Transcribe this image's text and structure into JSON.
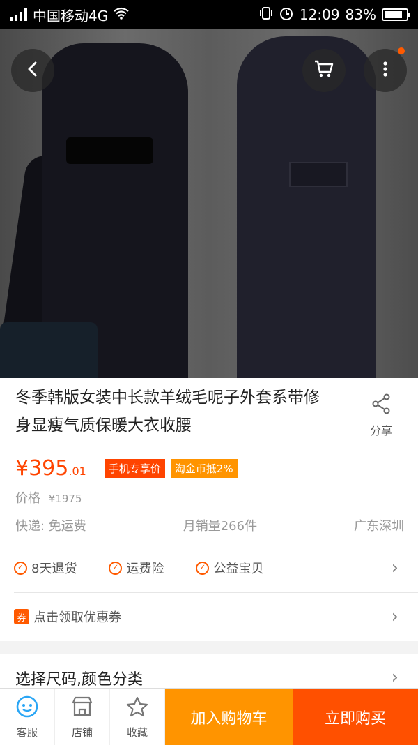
{
  "status_bar": {
    "carrier": "中国移动4G",
    "time": "12:09",
    "battery": "83%",
    "battery_level": 0.83
  },
  "hero": {
    "carousel_count": 4,
    "carousel_active": 0,
    "icons": [
      "back-icon",
      "cart-icon",
      "more-icon"
    ]
  },
  "product": {
    "title": "冬季韩版女装中长款羊绒毛呢子外套系带修身显瘦气质保暖大衣收腰",
    "share_label": "分享",
    "price_symbol": "¥",
    "price_main": "395",
    "price_decimal": ".01",
    "tags": [
      "手机专享价",
      "淘金币抵2%"
    ],
    "original_label": "价格",
    "original_price": "¥1975",
    "shipping": "快递: 免运费",
    "monthly_sales": "月销量266件",
    "location": "广东深圳"
  },
  "services": {
    "items": [
      "8天退货",
      "运费险",
      "公益宝贝"
    ],
    "coupon_badge": "券",
    "coupon_text": "点击领取优惠券"
  },
  "choose": {
    "label": "选择尺码,颜色分类"
  },
  "bottom_bar": {
    "service_label": "客服",
    "shop_label": "店铺",
    "favorite_label": "收藏",
    "add_cart_label": "加入购物车",
    "buy_now_label": "立即购买"
  },
  "colors": {
    "accent_orange": "#ff5000",
    "cart_orange": "#ff9400",
    "price_red": "#ff4400"
  }
}
